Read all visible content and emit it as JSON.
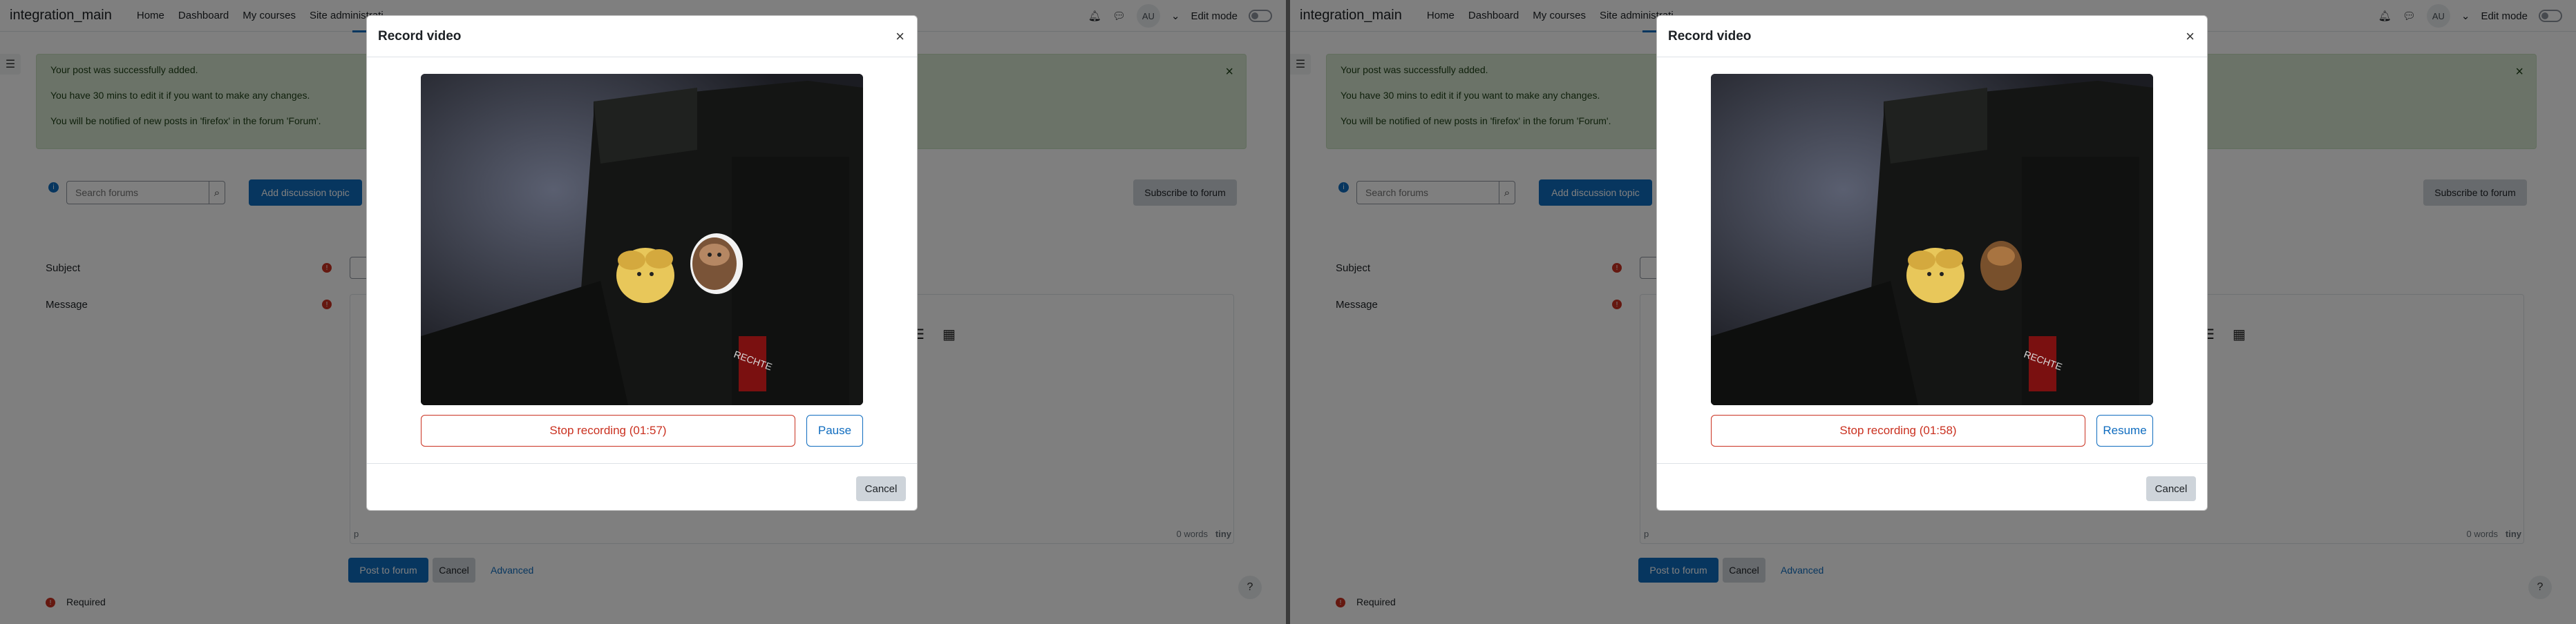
{
  "navbar": {
    "brand": "integration_main",
    "items": [
      "Home",
      "Dashboard",
      "My courses",
      "Site administrati"
    ],
    "avatar": "AU",
    "edit_mode": "Edit mode"
  },
  "alert": {
    "lines": [
      "Your post was successfully added.",
      "You have 30 mins to edit it if you want to make any changes.",
      "You will be notified of new posts in 'firefox' in the forum 'Forum'."
    ],
    "close": "×"
  },
  "forum": {
    "info": "i",
    "search_placeholder": "Search forums",
    "add_topic": "Add discussion topic",
    "subscribe": "Subscribe to forum"
  },
  "form": {
    "subject_label": "Subject",
    "message_label": "Message",
    "required_mark": "!",
    "editor_path": "p",
    "word_count": "0 words",
    "tiny_logo": "tiny",
    "post_button": "Post to forum",
    "cancel_button": "Cancel",
    "advanced_link": "Advanced",
    "help": "?",
    "required_note": "Required"
  },
  "panes": [
    {
      "modal": {
        "title": "Record video",
        "close": "×",
        "stop_label": "Stop recording (01:57)",
        "toggle_label": "Pause",
        "cancel_label": "Cancel"
      }
    },
    {
      "modal": {
        "title": "Record video",
        "close": "×",
        "stop_label": "Stop recording (01:58)",
        "toggle_label": "Resume",
        "cancel_label": "Cancel"
      }
    }
  ],
  "colors": {
    "primary": "#0f6cbf",
    "danger": "#ca3120",
    "alert_bg": "#d7e6d1"
  }
}
